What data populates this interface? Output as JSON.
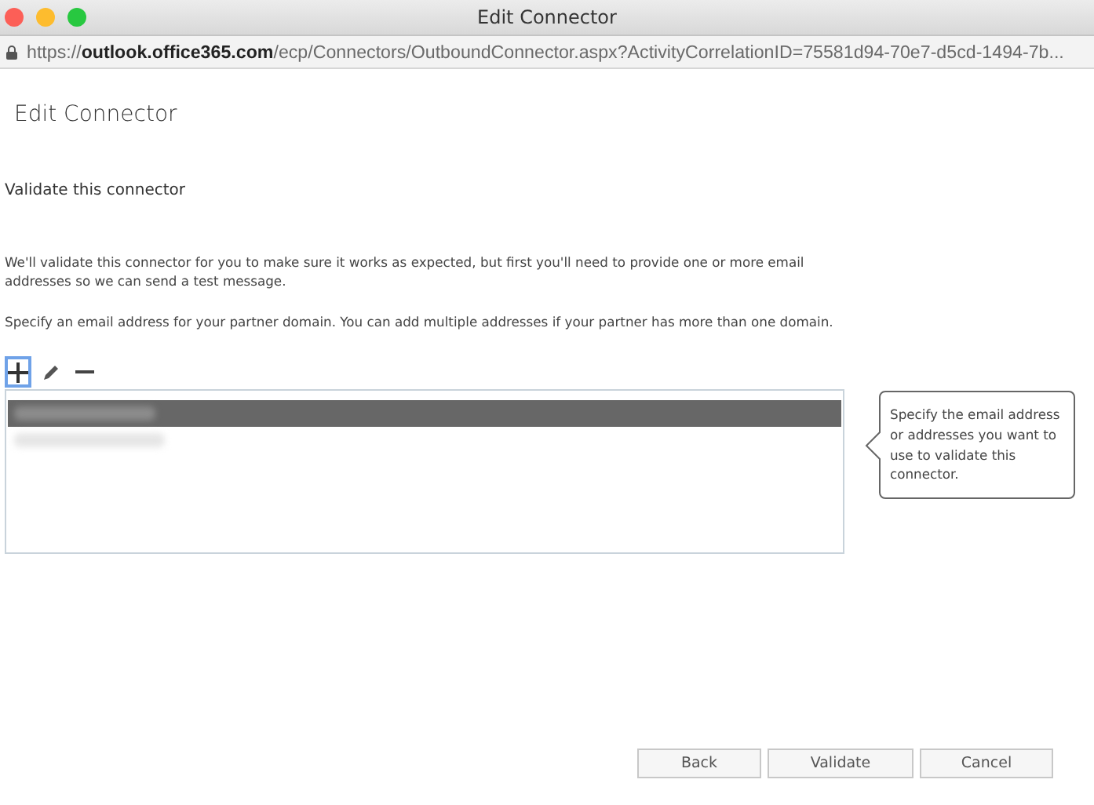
{
  "window": {
    "title": "Edit Connector"
  },
  "address_bar": {
    "url": "https://**outlook.office365.com**/ecp/Connectors/OutboundConnector.aspx?ActivityCorrelationID=75581d94-70e7-d5cd-1494-7b..."
  },
  "page_title": "Edit Connector",
  "section_title": "Validate this connector",
  "paragraphs": [
    "We'll validate this connector for you to make sure it works as expected, but first you'll need to provide one or more email addresses so we can send a test message.",
    "Specify an email address for your partner domain. You can add multiple addresses if your partner has more than one domain."
  ],
  "toolbar": [
    {
      "kind": "add",
      "selected": true
    },
    {
      "kind": "edit",
      "selected": false
    },
    {
      "kind": "remove",
      "selected": false
    }
  ],
  "email_list": {
    "rows": [
      {
        "selected": true
      },
      {
        "selected": false
      }
    ]
  },
  "tooltip": "Specify the email address or addresses you want to use to validate this connector.",
  "buttons": [
    "Back",
    "Validate",
    "Cancel"
  ]
}
